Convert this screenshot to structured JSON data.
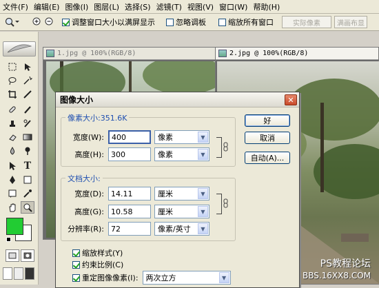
{
  "menu": [
    "文件(F)",
    "编辑(E)",
    "图像(I)",
    "图层(L)",
    "选择(S)",
    "滤镜(T)",
    "视图(V)",
    "窗口(W)",
    "帮助(H)"
  ],
  "options_bar": {
    "resize_label": "调整窗口大小以满屏显示",
    "ignore_palettes_label": "忽略调板",
    "zoom_all_label": "缩放所有窗口",
    "actual_pixels": "实际像素",
    "fit_screen": "满画布显"
  },
  "documents": [
    {
      "title": "1.jpg @ 100%(RGB/8)"
    },
    {
      "title": "2.jpg @ 100%(RGB/8)"
    }
  ],
  "dialog": {
    "title": "图像大小",
    "pixel_dims_label": "像素大小:351.6K",
    "width_label": "宽度(W):",
    "width_value": "400",
    "width_unit": "像素",
    "height_label": "高度(H):",
    "height_value": "300",
    "height_unit": "像素",
    "doc_size_label": "文档大小:",
    "doc_width_label": "宽度(D):",
    "doc_width_value": "14.11",
    "doc_width_unit": "厘米",
    "doc_height_label": "高度(G):",
    "doc_height_value": "10.58",
    "doc_height_unit": "厘米",
    "resolution_label": "分辨率(R):",
    "resolution_value": "72",
    "resolution_unit": "像素/英寸",
    "scale_styles_label": "缩放样式(Y)",
    "constrain_label": "约束比例(C)",
    "resample_label": "重定图像像素(I):",
    "resample_value": "两次立方",
    "ok": "好",
    "cancel": "取消",
    "auto": "自动(A)..."
  },
  "watermark": {
    "line1": "PS教程论坛",
    "line2": "BBS.16XX8.COM"
  },
  "colors": {
    "foreground": "#22cc33",
    "background": "#ffffff",
    "accent": "#3a5fa8"
  }
}
